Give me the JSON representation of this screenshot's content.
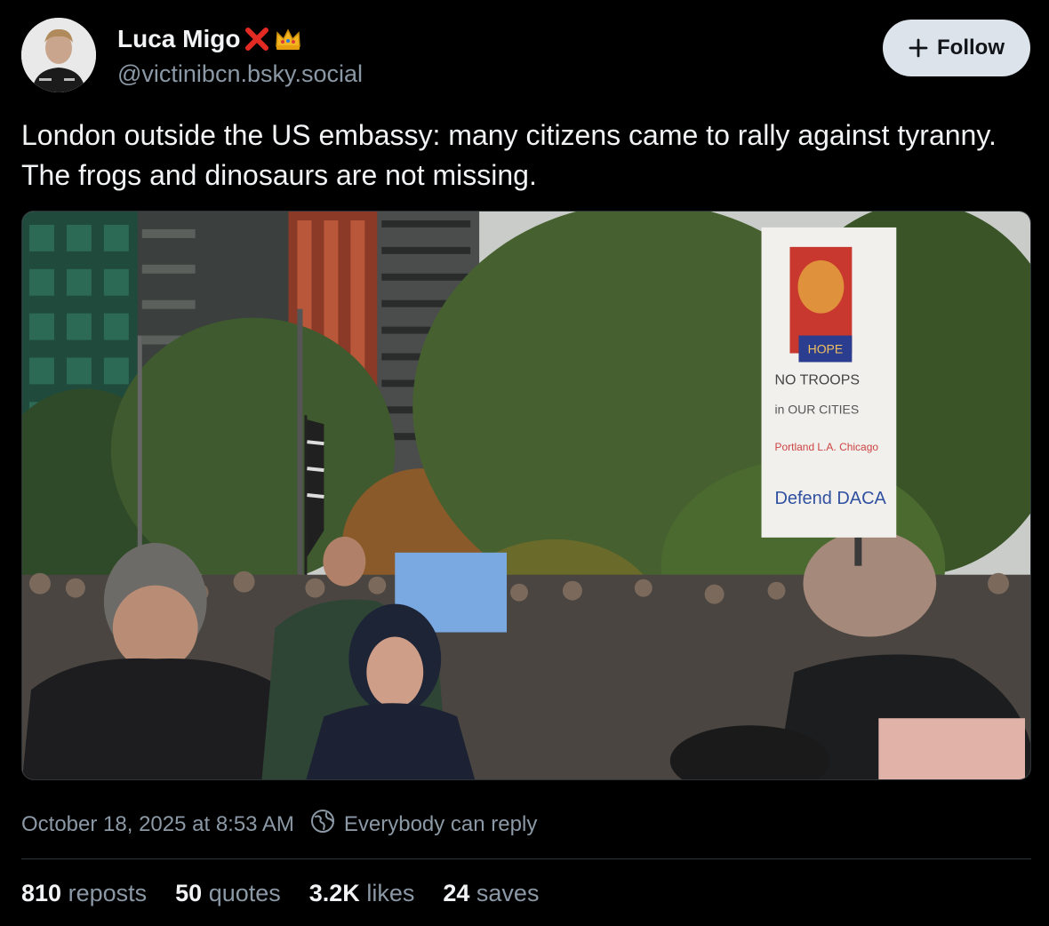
{
  "author": {
    "display_name": "Luca Migo",
    "handle": "@victinibcn.bsky.social",
    "badges": [
      "cross-mark-icon",
      "crown-icon"
    ],
    "avatar_icon": "avatar"
  },
  "follow_button": {
    "label": "Follow",
    "icon": "plus-icon"
  },
  "post": {
    "text": "London outside the US embassy: many citizens came to rally against tyranny. The frogs and dinosaurs are not missing.",
    "media": {
      "type": "video-thumbnail",
      "sign_text": [
        "HOPE",
        "NO TROOPS",
        "in OUR CITIES",
        "Portland L.A. Chicago",
        "Defend DACA"
      ]
    }
  },
  "meta": {
    "timestamp": "October 18, 2025 at 8:53 AM",
    "reply_setting": "Everybody can reply",
    "reply_icon": "globe-icon"
  },
  "stats": {
    "reposts": {
      "count": "810",
      "label": "reposts"
    },
    "quotes": {
      "count": "50",
      "label": "quotes"
    },
    "likes": {
      "count": "3.2K",
      "label": "likes"
    },
    "saves": {
      "count": "24",
      "label": "saves"
    }
  },
  "colors": {
    "background": "#000000",
    "text": "#f1f3f5",
    "muted": "#8b98a5",
    "follow_bg": "#dce3ea",
    "divider": "#2e3338"
  }
}
